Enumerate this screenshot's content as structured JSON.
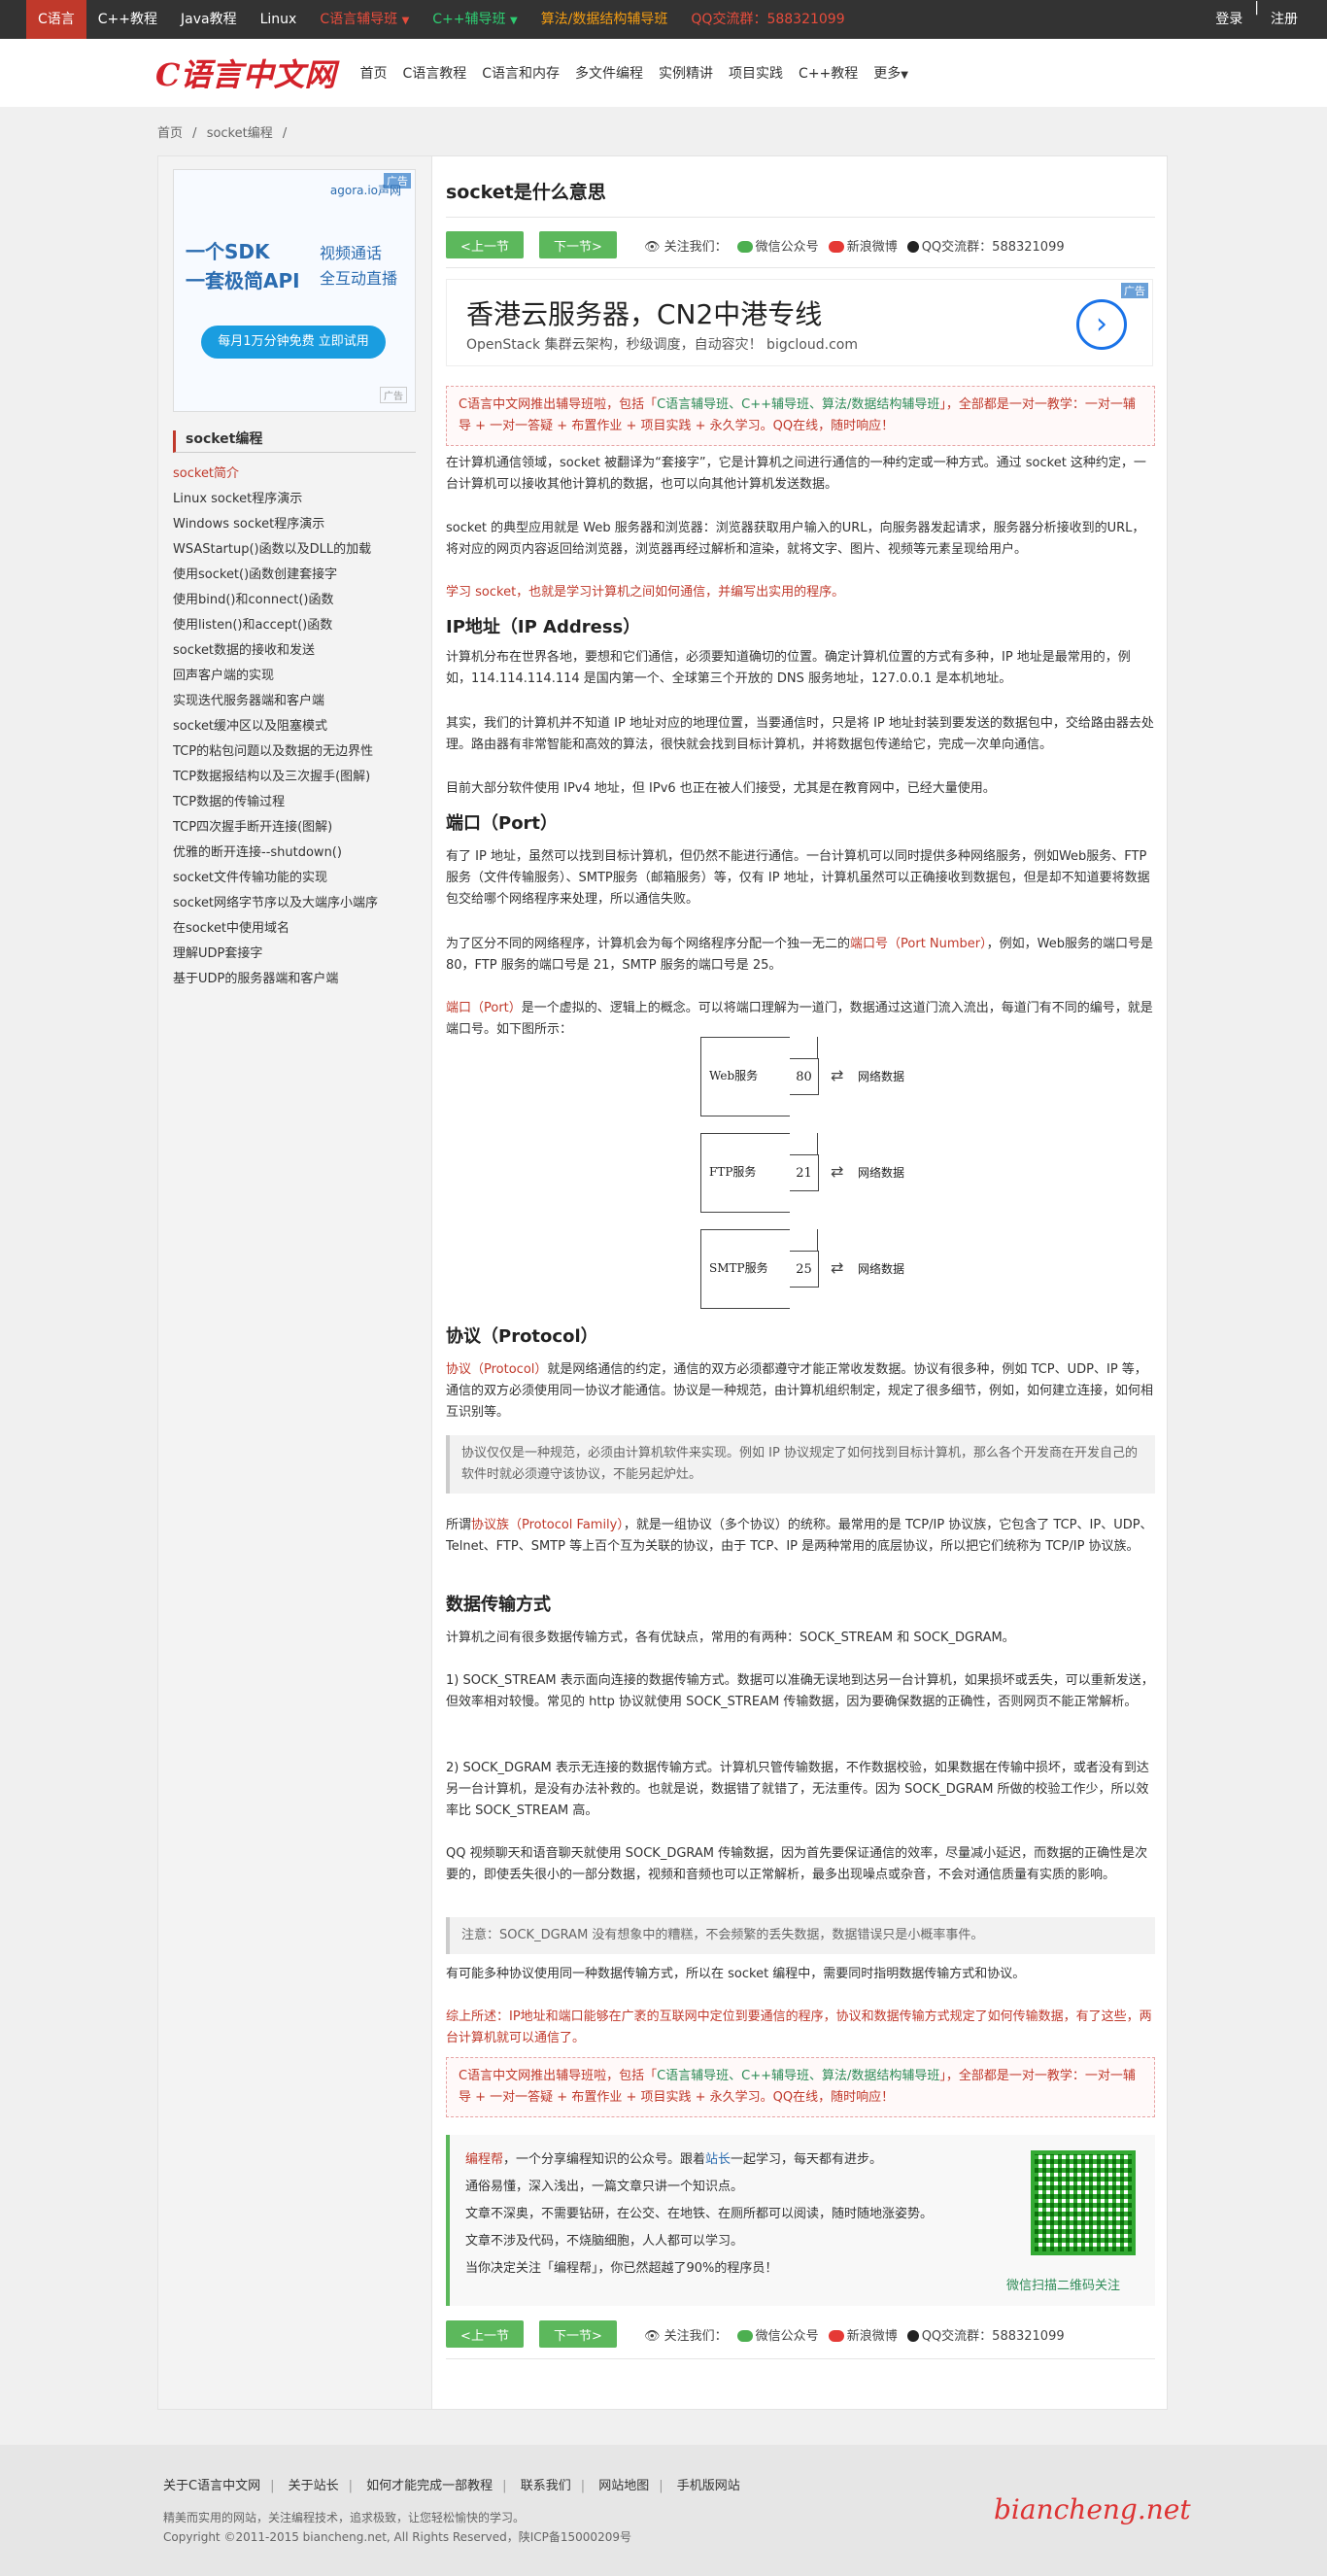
{
  "topbar": {
    "items": [
      "C语言",
      "C++教程",
      "Java教程",
      "Linux",
      "C语言辅导班",
      "C++辅导班",
      "算法/数据结构辅导班",
      "QQ交流群：588321099"
    ],
    "login": "登录",
    "register": "注册"
  },
  "header": {
    "logo": "C语言中文网",
    "nav": [
      "首页",
      "C语言教程",
      "C语言和内存",
      "多文件编程",
      "实例精讲",
      "项目实践",
      "C++教程",
      "更多"
    ]
  },
  "breadcrumb": [
    "首页",
    "/",
    "socket编程",
    "/"
  ],
  "sidebar": {
    "ad": {
      "tag": "广告",
      "brand": "agora.io声网",
      "line1": "一个SDK",
      "line2": "一套极简API",
      "right1": "视频通话",
      "right2": "全互动直播",
      "cta": "每月1万分钟免费 立即试用",
      "small": "广告"
    },
    "title": "socket编程",
    "items": [
      "socket简介",
      "Linux socket程序演示",
      "Windows socket程序演示",
      "WSAStartup()函数以及DLL的加载",
      "使用socket()函数创建套接字",
      "使用bind()和connect()函数",
      "使用listen()和accept()函数",
      "socket数据的接收和发送",
      "回声客户端的实现",
      "实现迭代服务器端和客户端",
      "socket缓冲区以及阻塞模式",
      "TCP的粘包问题以及数据的无边界性",
      "TCP数据报结构以及三次握手(图解)",
      "TCP数据的传输过程",
      "TCP四次握手断开连接(图解)",
      "优雅的断开连接--shutdown()",
      "socket文件传输功能的实现",
      "socket网络字节序以及大端序小端序",
      "在socket中使用域名",
      "理解UDP套接字",
      "基于UDP的服务器端和客户端"
    ]
  },
  "article": {
    "title": "socket是什么意思",
    "prev": "<上一节",
    "next": "下一节>",
    "share": {
      "follow": "关注我们：",
      "wechat": "微信公众号",
      "weibo": "新浪微博",
      "qq": "QQ交流群：588321099"
    },
    "ad": {
      "tag": "广告",
      "headline": "香港云服务器，CN2中港专线",
      "sub": "OpenStack 集群云架构，秒级调度，自动容灾！ bigcloud.com",
      "arrow": "›"
    },
    "notice": {
      "pre": "C语言中文网推出辅导班啦，包括「",
      "courses": "C语言辅导班、C++辅导班、算法/数据结构辅导班",
      "post": "」，全部都是一对一教学：一对一辅导 + 一对一答疑 + 布置作业 + 项目实践 + 永久学习。QQ在线，随时响应！"
    },
    "p1": "在计算机通信领域，socket 被翻译为“套接字”，它是计算机之间进行通信的一种约定或一种方式。通过 socket 这种约定，一台计算机可以接收其他计算机的数据，也可以向其他计算机发送数据。",
    "p2": "socket 的典型应用就是 Web 服务器和浏览器：浏览器获取用户输入的URL，向服务器发起请求，服务器分析接收到的URL，将对应的网页内容返回给浏览器，浏览器再经过解析和渲染，就将文字、图片、视频等元素呈现给用户。",
    "p3": "学习 socket，也就是学习计算机之间如何通信，并编写出实用的程序。",
    "h_ip": "IP地址（IP Address）",
    "p4": "计算机分布在世界各地，要想和它们通信，必须要知道确切的位置。确定计算机位置的方式有多种，IP 地址是最常用的，例如，114.114.114.114 是国内第一个、全球第三个开放的 DNS 服务地址，127.0.0.1 是本机地址。",
    "p5": "其实，我们的计算机并不知道 IP 地址对应的地理位置，当要通信时，只是将 IP 地址封装到要发送的数据包中，交给路由器去处理。路由器有非常智能和高效的算法，很快就会找到目标计算机，并将数据包传递给它，完成一次单向通信。",
    "p6": "目前大部分软件使用 IPv4 地址，但 IPv6 也正在被人们接受，尤其是在教育网中，已经大量使用。",
    "h_port": "端口（Port）",
    "p7": "有了 IP 地址，虽然可以找到目标计算机，但仍然不能进行通信。一台计算机可以同时提供多种网络服务，例如Web服务、FTP服务（文件传输服务）、SMTP服务（邮箱服务）等，仅有 IP 地址，计算机虽然可以正确接收到数据包，但是却不知道要将数据包交给哪个网络程序来处理，所以通信失败。",
    "p8a": "为了区分不同的网络程序，计算机会为每个网络程序分配一个独一无二的",
    "p8b": "端口号（Port Number）",
    "p8c": "，例如，Web服务的端口号是 80，FTP 服务的端口号是 21，SMTP 服务的端口号是 25。",
    "p9a": "端口（Port）",
    "p9b": "是一个虚拟的、逻辑上的概念。可以将端口理解为一道门，数据通过这道门流入流出，每道门有不同的编号，就是端口号。如下图所示：",
    "ports": [
      {
        "service": "Web服务",
        "port": "80",
        "data": "网络数据"
      },
      {
        "service": "FTP服务",
        "port": "21",
        "data": "网络数据"
      },
      {
        "service": "SMTP服务",
        "port": "25",
        "data": "网络数据"
      }
    ],
    "h_proto": "协议（Protocol）",
    "p10a": "协议（Protocol）",
    "p10b": "就是网络通信的约定，通信的双方必须都遵守才能正常收发数据。协议有很多种，例如 TCP、UDP、IP 等，通信的双方必须使用同一协议才能通信。协议是一种规范，由计算机组织制定，规定了很多细节，例如，如何建立连接，如何相互识别等。",
    "q1": "协议仅仅是一种规范，必须由计算机软件来实现。例如 IP 协议规定了如何找到目标计算机，那么各个开发商在开发自己的软件时就必须遵守该协议，不能另起炉灶。",
    "p11a": "所谓",
    "p11b": "协议族（Protocol Family）",
    "p11c": "，就是一组协议（多个协议）的统称。最常用的是 TCP/IP 协议族，它包含了 TCP、IP、UDP、Telnet、FTP、SMTP 等上百个互为关联的协议，由于 TCP、IP 是两种常用的底层协议，所以把它们统称为 TCP/IP 协议族。",
    "h_trans": "数据传输方式",
    "p12": "计算机之间有很多数据传输方式，各有优缺点，常用的有两种：SOCK_STREAM 和 SOCK_DGRAM。",
    "p13": "1) SOCK_STREAM 表示面向连接的数据传输方式。数据可以准确无误地到达另一台计算机，如果损坏或丢失，可以重新发送，但效率相对较慢。常见的 http 协议就使用 SOCK_STREAM 传输数据，因为要确保数据的正确性，否则网页不能正常解析。",
    "p14": "2) SOCK_DGRAM 表示无连接的数据传输方式。计算机只管传输数据，不作数据校验，如果数据在传输中损坏，或者没有到达另一台计算机，是没有办法补救的。也就是说，数据错了就错了，无法重传。因为 SOCK_DGRAM 所做的校验工作少，所以效率比 SOCK_STREAM 高。",
    "p15": "QQ 视频聊天和语音聊天就使用 SOCK_DGRAM 传输数据，因为首先要保证通信的效率，尽量减小延迟，而数据的正确性是次要的，即使丢失很小的一部分数据，视频和音频也可以正常解析，最多出现噪点或杂音，不会对通信质量有实质的影响。",
    "q2": "注意：SOCK_DGRAM 没有想象中的糟糕，不会频繁的丢失数据，数据错误只是小概率事件。",
    "p16": "有可能多种协议使用同一种数据传输方式，所以在 socket 编程中，需要同时指明数据传输方式和协议。",
    "p17": "综上所述：IP地址和端口能够在广袤的互联网中定位到要通信的程序，协议和数据传输方式规定了如何传输数据，有了这些，两台计算机就可以通信了。",
    "bcg": {
      "l1a": "编程帮",
      "l1b": "，一个分享编程知识的公众号。跟着",
      "l1c": "站长",
      "l1d": "一起学习，每天都有进步。",
      "l2": "通俗易懂，深入浅出，一篇文章只讲一个知识点。",
      "l3": "文章不深奥，不需要钻研，在公交、在地铁、在厕所都可以阅读，随时随地涨姿势。",
      "l4": "文章不涉及代码，不烧脑细胞，人人都可以学习。",
      "l5": "当你决定关注「编程帮」，你已然超越了90%的程序员！",
      "qr_label": "微信扫描二维码关注"
    }
  },
  "footer": {
    "links": [
      "关于C语言中文网",
      "关于站长",
      "如何才能完成一部教程",
      "联系我们",
      "网站地图",
      "手机版网站"
    ],
    "slogan": "精美而实用的网站，关注编程技术，追求极致，让您轻松愉快的学习。",
    "copyright": "Copyright ©2011-2015 biancheng.net, All Rights Reserved，陕ICP备15000209号",
    "sign": "biancheng.net"
  }
}
